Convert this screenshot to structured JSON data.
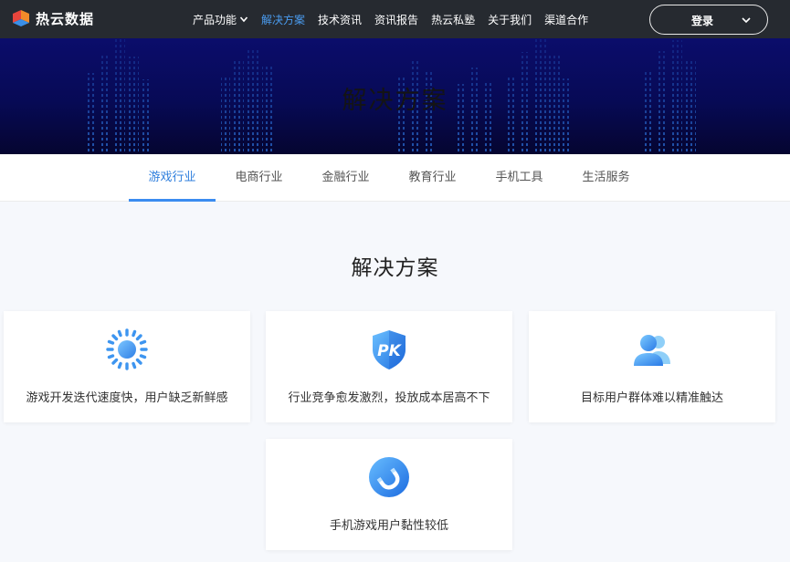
{
  "brand": {
    "name": "热云数据"
  },
  "nav": {
    "items": [
      {
        "label": "产品功能",
        "has_dropdown": true,
        "active": false
      },
      {
        "label": "解决方案",
        "active": true
      },
      {
        "label": "技术资讯",
        "active": false
      },
      {
        "label": "资讯报告",
        "active": false
      },
      {
        "label": "热云私塾",
        "active": false
      },
      {
        "label": "关于我们",
        "active": false
      },
      {
        "label": "渠道合作",
        "active": false
      }
    ],
    "login_label": "登录"
  },
  "banner": {
    "title": "解决方案"
  },
  "tabs": [
    {
      "label": "游戏行业",
      "active": true
    },
    {
      "label": "电商行业"
    },
    {
      "label": "金融行业"
    },
    {
      "label": "教育行业"
    },
    {
      "label": "手机工具"
    },
    {
      "label": "生活服务"
    }
  ],
  "section": {
    "title": "解决方案"
  },
  "cards": [
    {
      "icon": "sun-icon",
      "text": "游戏开发迭代速度快，用户缺乏新鲜感"
    },
    {
      "icon": "pk-shield-icon",
      "text": "行业竞争愈发激烈，投放成本居高不下"
    },
    {
      "icon": "users-icon",
      "text": "目标用户群体难以精准触达"
    },
    {
      "icon": "magnet-icon",
      "text": "手机游戏用户黏性较低"
    }
  ],
  "colors": {
    "accent": "#2f7fdd",
    "topbar": "#262a30",
    "banner": "#0b0d6b",
    "card_bg": "#ffffff",
    "page_bg": "#f6f8fc"
  }
}
